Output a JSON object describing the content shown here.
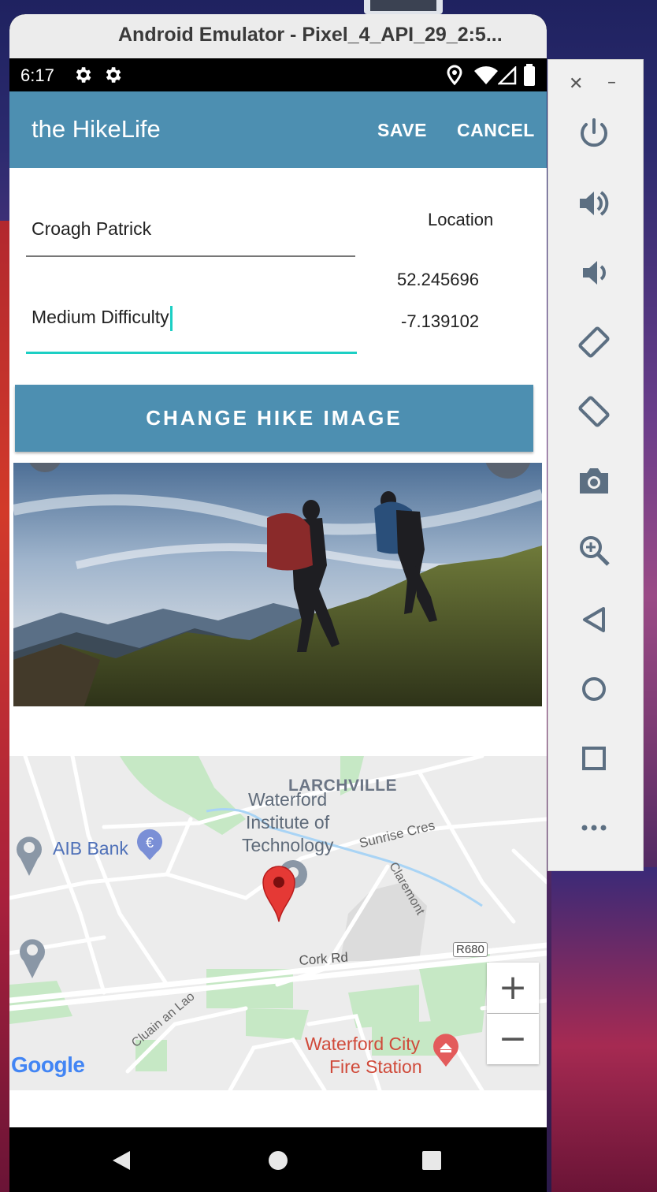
{
  "window": {
    "title": "Android Emulator - Pixel_4_API_29_2:5..."
  },
  "status_bar": {
    "time": "6:17"
  },
  "app_bar": {
    "title": "the HikeLife",
    "save": "SAVE",
    "cancel": "CANCEL"
  },
  "form": {
    "name_value": "Croagh Patrick",
    "description_value": "Medium Difficulty",
    "location_label": "Location",
    "latitude": "52.245696",
    "longitude": "-7.139102",
    "change_image_button": "CHANGE HIKE IMAGE"
  },
  "map": {
    "labels": {
      "larchville": "LARCHVILLE",
      "institute_1": "Waterford",
      "institute_2": "Institute of",
      "institute_3": "Technology",
      "aib": "AIB Bank",
      "sunrise": "Sunrise Cres",
      "claremont": "Claremont",
      "r680": "R680",
      "cork_rd": "Cork Rd",
      "cluain": "Cluain an Lao",
      "fire_1": "Waterford City",
      "fire_2": "Fire Station",
      "google": "Google"
    },
    "zoom_in": "+",
    "zoom_out": "−"
  },
  "colors": {
    "primary": "#4d8fb1",
    "accent": "#1ccfc4",
    "marker": "#e53935"
  }
}
